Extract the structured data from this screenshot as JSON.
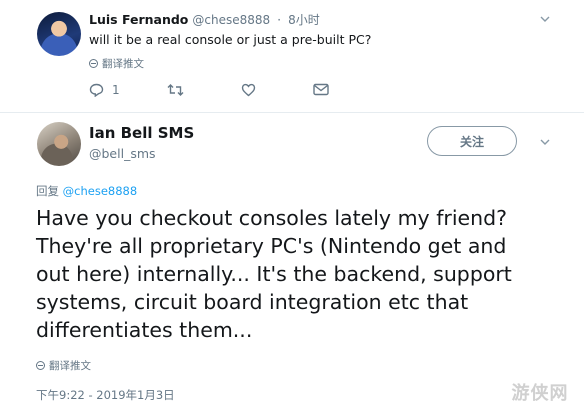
{
  "reply_tweet": {
    "name": "Luis Fernando",
    "handle": "@chese8888",
    "separator": "·",
    "time": "8小时",
    "text": "will it be a real console or just a pre-built PC?",
    "translate_label": "翻译推文",
    "actions": {
      "reply_count": "1",
      "reply_icon": "reply-icon",
      "retweet_icon": "retweet-icon",
      "like_icon": "heart-icon",
      "dm_icon": "envelope-icon"
    }
  },
  "main_tweet": {
    "name": "Ian Bell SMS",
    "handle": "@bell_sms",
    "follow_label": "关注",
    "replying_prefix": "回复",
    "replying_to": "@chese8888",
    "lines": [
      "Have you checkout consoles lately my friend?",
      "They're all proprietary PC's (Nintendo get and",
      "out here) internally... It's the backend, support",
      "systems, circuit board integration etc that",
      "differentiates them..."
    ],
    "translate_label": "翻译推文",
    "timestamp": "下午9:22 - 2019年1月3日"
  },
  "watermark": "游侠网",
  "colors": {
    "text": "#14171a",
    "secondary": "#657786",
    "link": "#1da1f2",
    "divider": "#e6ecf0"
  }
}
